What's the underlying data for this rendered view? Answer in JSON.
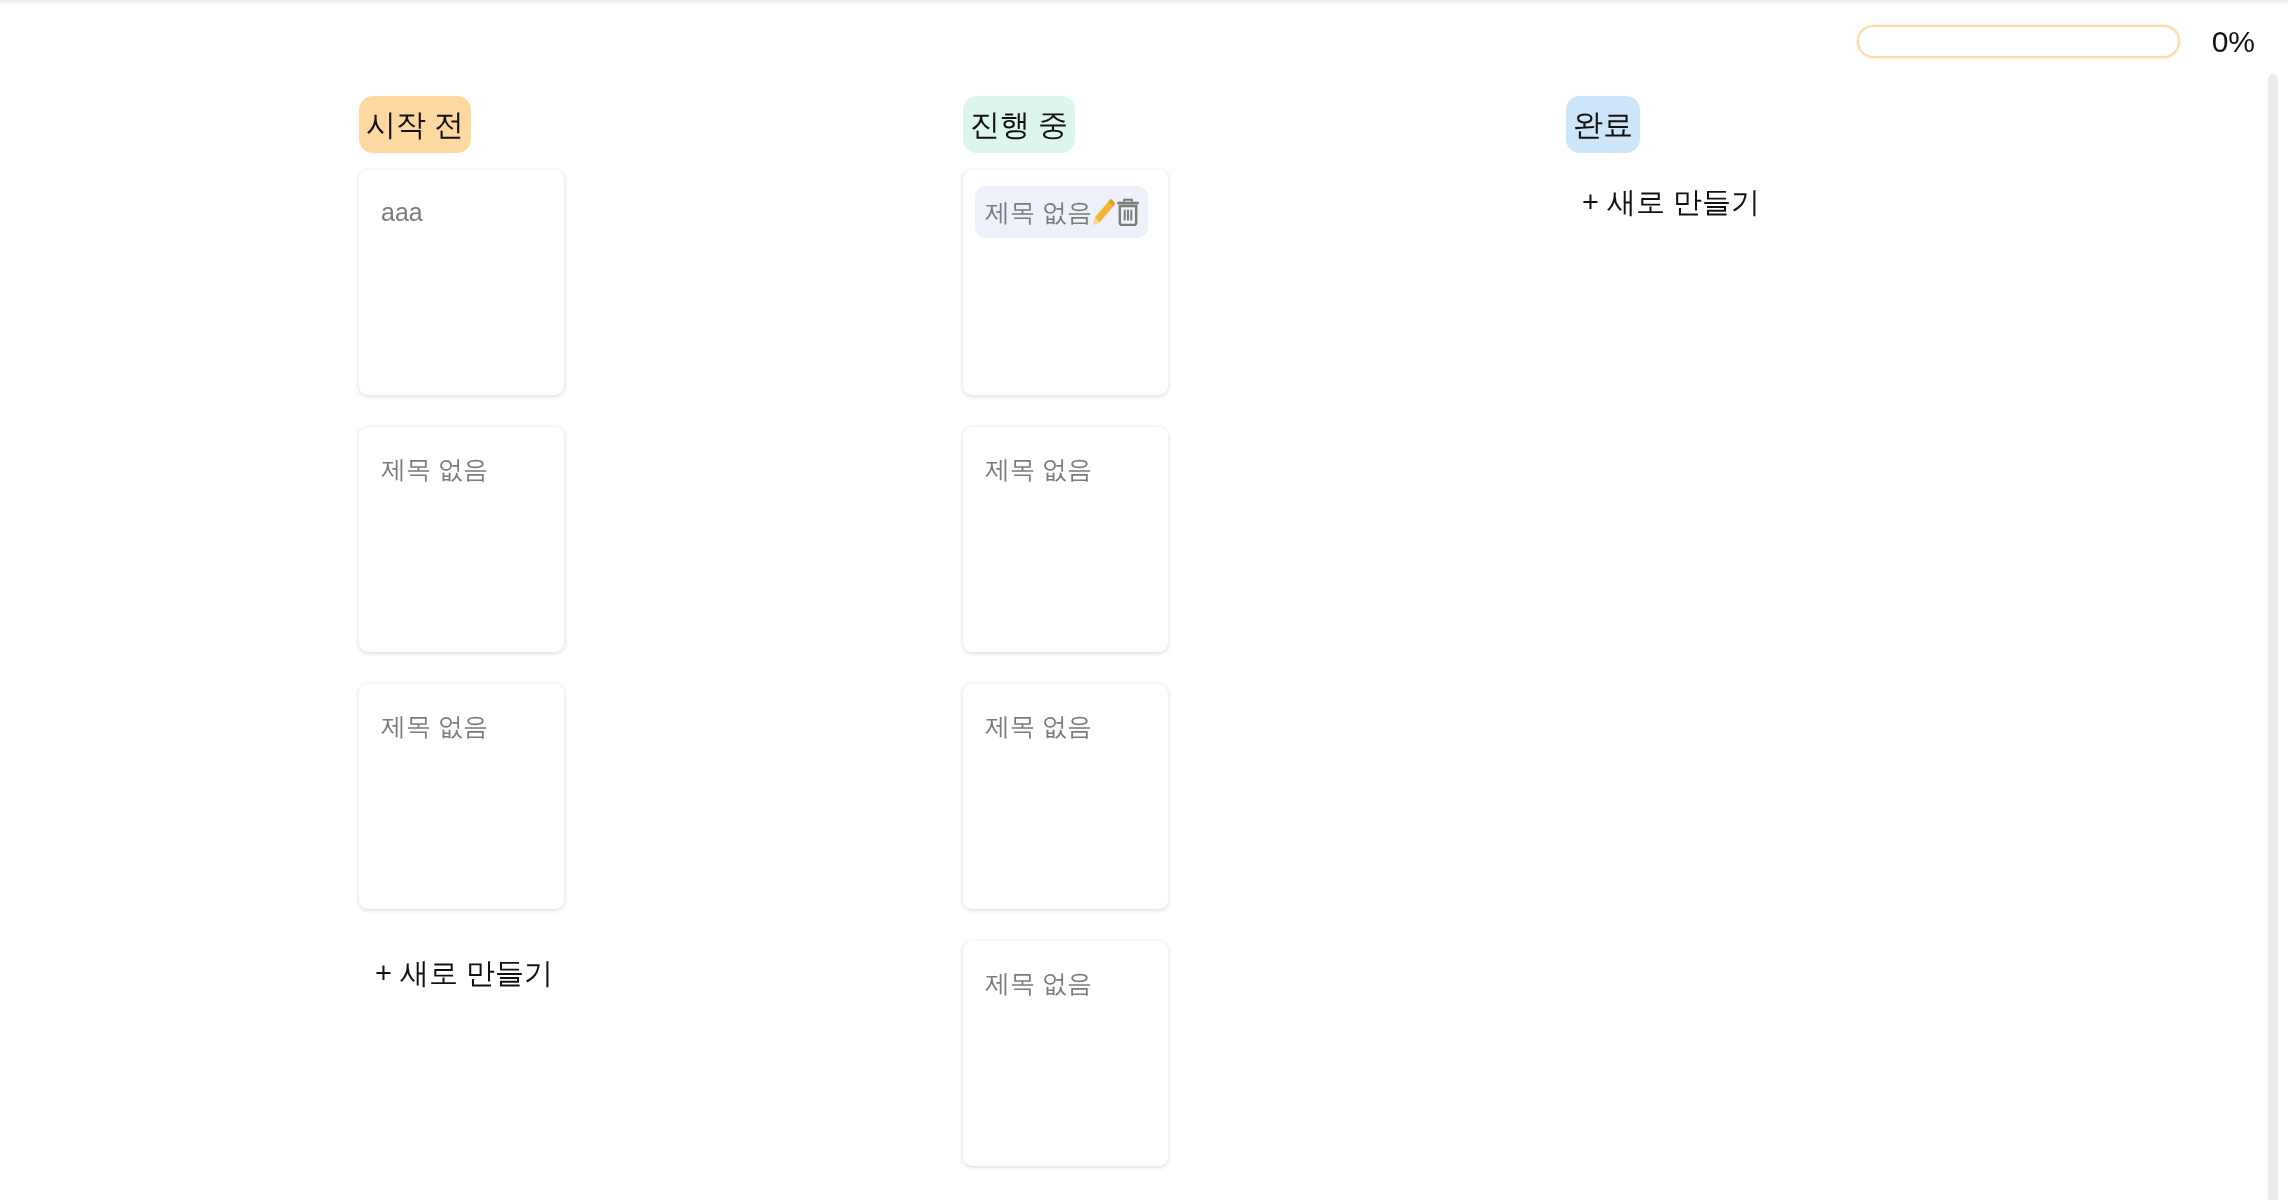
{
  "progress": {
    "level": 0,
    "reading": "0%"
  },
  "columns": [
    {
      "title": "시작 전",
      "color": "#fdd8a0",
      "cards": [
        {
          "title": "aaa",
          "hovered": false
        },
        {
          "title": "제목 없음",
          "hovered": false
        },
        {
          "title": "제목 없음",
          "hovered": false
        }
      ],
      "new_button": "+ 새로 만들기"
    },
    {
      "title": "진행 중",
      "color": "#dcf6ec",
      "cards": [
        {
          "title": "제목 없음",
          "hovered": true
        },
        {
          "title": "제목 없음",
          "hovered": false
        },
        {
          "title": "제목 없음",
          "hovered": false
        },
        {
          "title": "제목 없음",
          "hovered": false
        }
      ]
    },
    {
      "title": "완료",
      "color": "#cce5f8",
      "new_button": "+ 새로 만들기"
    }
  ]
}
